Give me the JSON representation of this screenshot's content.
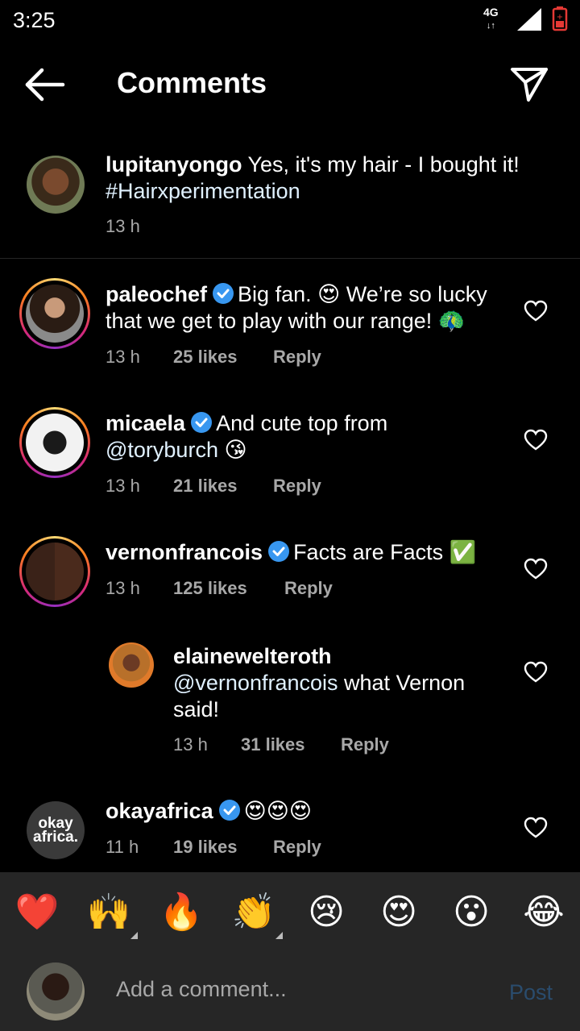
{
  "status": {
    "time": "3:25",
    "network": "4G"
  },
  "header": {
    "title": "Comments"
  },
  "caption": {
    "username": "lupitanyongo",
    "text": "Yes, it's my hair - I bought it!",
    "hashtag": "#Hairxperimentation",
    "time": "13 h"
  },
  "comments": [
    {
      "username": "paleochef",
      "verified": true,
      "text": "Big fan. 😍 We’re so lucky that we get to play with our range! 🦚",
      "time": "13 h",
      "likes": "25 likes",
      "reply": "Reply"
    },
    {
      "username": "micaela",
      "verified": true,
      "text_before": "And cute top from",
      "mention": "@toryburch",
      "text_after": "😘",
      "time": "13 h",
      "likes": "21 likes",
      "reply": "Reply"
    },
    {
      "username": "vernonfrancois",
      "verified": true,
      "text": "Facts are Facts ✅",
      "time": "13 h",
      "likes": "125 likes",
      "reply": "Reply"
    },
    {
      "username": "elainewelteroth",
      "verified": false,
      "mention": "@vernonfrancois",
      "text": "what Vernon said!",
      "time": "13 h",
      "likes": "31 likes",
      "reply": "Reply"
    },
    {
      "username": "okayafrica",
      "verified": true,
      "text": "😍😍😍",
      "time": "11 h",
      "likes": "19 likes",
      "reply": "Reply",
      "avatar_text": "okay africa."
    }
  ],
  "emoji_bar": [
    "❤️",
    "🙌",
    "🔥",
    "👏",
    "😢",
    "😍",
    "😮",
    "😂"
  ],
  "compose": {
    "placeholder": "Add a comment...",
    "post_label": "Post"
  },
  "colors": {
    "background": "#000000",
    "meta": "#a8a8a8",
    "verified": "#3897f0",
    "post_disabled": "#2a4c6d",
    "bar": "#262626"
  }
}
